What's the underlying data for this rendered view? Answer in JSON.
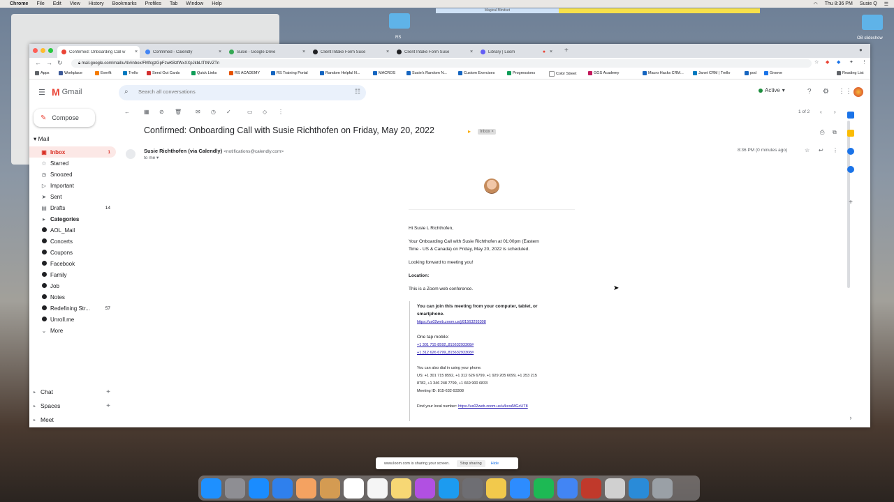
{
  "menubar": {
    "app": "Chrome",
    "items": [
      "File",
      "Edit",
      "View",
      "History",
      "Bookmarks",
      "Profiles",
      "Tab",
      "Window",
      "Help"
    ],
    "clock": "Thu 8:36 PM",
    "user": "Susie Q"
  },
  "desktop": {
    "folder1_label": "RS",
    "folder2_label": "OB slideshow",
    "blue_bar_text": "Magical Mindset"
  },
  "tabs": [
    {
      "title": "Confirmed: Onboarding Call w",
      "color": "#ea4335"
    },
    {
      "title": "Confirmed - Calendly",
      "color": "#4285f4"
    },
    {
      "title": "Susie - Google Drive",
      "color": "#34a853"
    },
    {
      "title": "Client Intake Form Suse",
      "color": "#202124"
    },
    {
      "title": "Client Intake Form Suse",
      "color": "#202124"
    },
    {
      "title": "Library | Loom",
      "color": "#625df5"
    }
  ],
  "address": "mail.google.com/mail/u/4/#inbox/FMfcgzGpFzwKBzfWxXXpJkbLtTtNVZTn",
  "bookmarks": [
    "Apps",
    "Workplace",
    "Everfit",
    "Trello",
    "Send Out Cards",
    "Quick Links",
    "RS ACADEMY",
    "RS Training Portal",
    "Random Helpful N...",
    "MACROS",
    "Susie's Random N...",
    "Custom Exercises",
    "Progressions",
    "Color Street",
    "GGS Academy",
    "Macro Hacks CRM...",
    "Janet CRM | Trello",
    "pod",
    "Groove",
    "Reading List"
  ],
  "gmail": {
    "brand": "Gmail",
    "search_placeholder": "Search all conversations",
    "status": "Active",
    "compose": "Compose",
    "mail_section": "Mail",
    "nav": [
      {
        "label": "Inbox",
        "count": "1",
        "icon": "inbox-icon",
        "glyph": "▣"
      },
      {
        "label": "Starred",
        "count": "",
        "icon": "star-icon",
        "glyph": "☆"
      },
      {
        "label": "Snoozed",
        "count": "",
        "icon": "clock-icon",
        "glyph": "◷"
      },
      {
        "label": "Important",
        "count": "",
        "icon": "important-icon",
        "glyph": "▷"
      },
      {
        "label": "Sent",
        "count": "",
        "icon": "send-icon",
        "glyph": "➤"
      },
      {
        "label": "Drafts",
        "count": "14",
        "icon": "draft-icon",
        "glyph": "▤"
      },
      {
        "label": "Categories",
        "count": "",
        "icon": "categories-icon",
        "glyph": "▸"
      }
    ],
    "labels": [
      {
        "label": "AOL_Mail",
        "count": ""
      },
      {
        "label": "Concerts",
        "count": ""
      },
      {
        "label": "Coupons",
        "count": ""
      },
      {
        "label": "Facebook",
        "count": ""
      },
      {
        "label": "Family",
        "count": ""
      },
      {
        "label": "Job",
        "count": ""
      },
      {
        "label": "Notes",
        "count": ""
      },
      {
        "label": "Redefining Str...",
        "count": "57"
      },
      {
        "label": "Unroll.me",
        "count": ""
      }
    ],
    "more": "More",
    "chat": "Chat",
    "spaces": "Spaces",
    "meet": "Meet",
    "pager": "1 of 2"
  },
  "email": {
    "subject": "Confirmed: Onboarding Call with Susie Richthofen on Friday, May 20, 2022",
    "inbox_chip": "Inbox ×",
    "sender_name": "Susie Richthofen (via Calendly)",
    "sender_email": "<notifications@calendly.com>",
    "to": "to me ▾",
    "time": "8:36 PM (0 minutes ago)",
    "greeting": "Hi Susie L Richthofen,",
    "line1": "Your Onboarding Call with Susie Richthofen at 01:00pm (Eastern",
    "line2": "Time - US & Canada) on Friday, May 20, 2022 is scheduled.",
    "looking": "Looking forward to meeting you!",
    "location_label": "Location:",
    "location": "This is a Zoom web conference.",
    "join1": "You can join this meeting from your computer, tablet, or",
    "join2": "smartphone.",
    "join_link": "https://us02web.zoom.us/j/81563293308",
    "one_tap": "One tap mobile:",
    "tap1": "+1 301 715 8592,,81563293308#",
    "tap2": "+1 312 626 6799,,81563293308#",
    "dial_intro": "You can also dial in using your phone.",
    "dial1": "US: +1 301 715 8592, +1 312 626 6799, +1 929 205 6099, +1 253 215",
    "dial2": "8782, +1 346 248 7799, +1 669 900 6833",
    "meeting_id": "Meeting ID: 815-632-93308",
    "local_label": "Find your local number:",
    "local_link": "https://us02web.zoom.us/u/kcoA8GcUT8"
  },
  "loom": {
    "message": "www.loom.com is sharing your screen.",
    "stop": "Stop sharing",
    "hide": "Hide"
  },
  "dock_colors": [
    "#1e90ff",
    "#8e8e93",
    "#1a8cff",
    "#2f80ed",
    "#f4a261",
    "#d49b52",
    "#ffffff",
    "#f5f5f5",
    "#f7d774",
    "#b150e2",
    "#1c9bf0",
    "#6e6e73",
    "#f2c94c",
    "#2d8cff",
    "#1db954",
    "#4285f4",
    "#c0392b",
    "#d0d0d0",
    "#2a8bd8",
    "#9aa0a6"
  ]
}
